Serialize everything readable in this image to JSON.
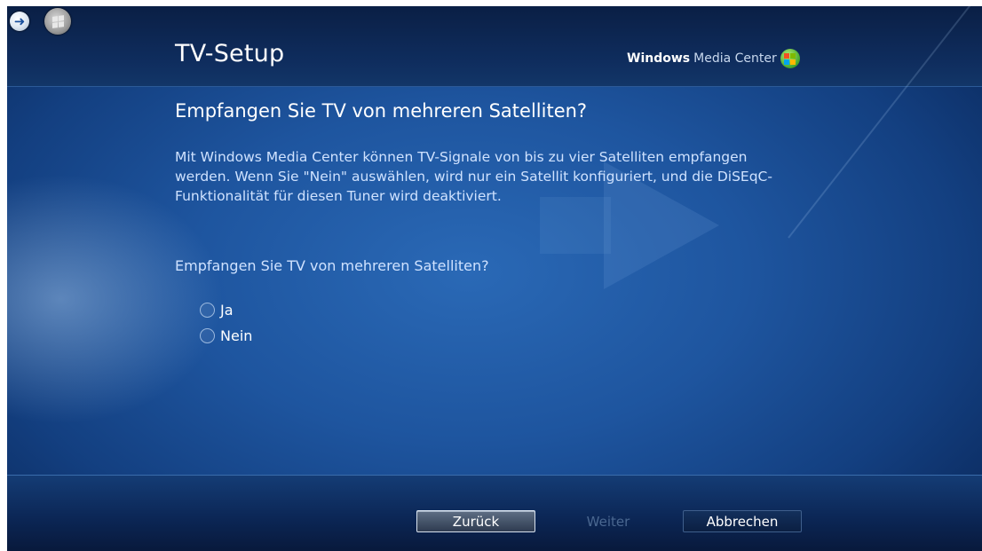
{
  "header": {
    "title": "TV-Setup",
    "brand_bold": "Windows",
    "brand_light": "Media Center"
  },
  "nav": {
    "back_icon": "back-arrow-icon",
    "start_icon": "windows-start-icon"
  },
  "content": {
    "heading": "Empfangen Sie TV von mehreren Satelliten?",
    "description": "Mit Windows Media Center können TV-Signale von bis zu vier Satelliten empfangen werden. Wenn Sie \"Nein\" auswählen, wird nur ein Satellit konfiguriert, und die DiSEqC-Funktionalität für diesen Tuner wird deaktiviert.",
    "question": "Empfangen Sie TV von mehreren Satelliten?",
    "options": [
      {
        "label": "Ja",
        "selected": false
      },
      {
        "label": "Nein",
        "selected": false
      }
    ]
  },
  "footer": {
    "back_label": "Zurück",
    "next_label": "Weiter",
    "cancel_label": "Abbrechen"
  },
  "colors": {
    "background": "#1e559f",
    "header_band": "#0f2d5e",
    "text_light": "#cfe2ff",
    "disabled_text": "#4a6790"
  }
}
